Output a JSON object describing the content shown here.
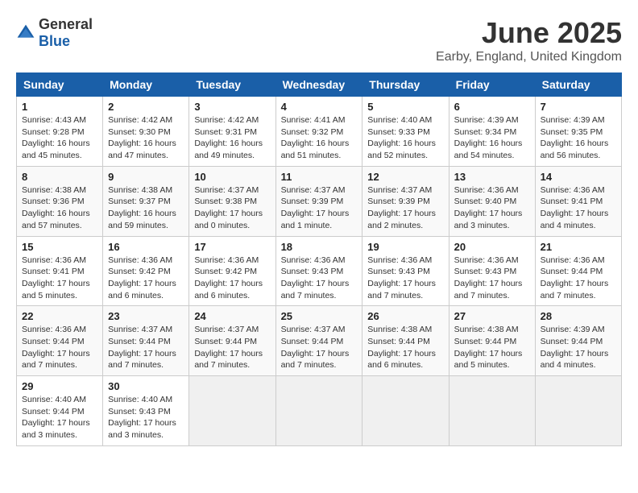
{
  "logo": {
    "general": "General",
    "blue": "Blue"
  },
  "title": "June 2025",
  "subtitle": "Earby, England, United Kingdom",
  "days_of_week": [
    "Sunday",
    "Monday",
    "Tuesday",
    "Wednesday",
    "Thursday",
    "Friday",
    "Saturday"
  ],
  "weeks": [
    [
      {
        "day": "1",
        "info": "Sunrise: 4:43 AM\nSunset: 9:28 PM\nDaylight: 16 hours and 45 minutes."
      },
      {
        "day": "2",
        "info": "Sunrise: 4:42 AM\nSunset: 9:30 PM\nDaylight: 16 hours and 47 minutes."
      },
      {
        "day": "3",
        "info": "Sunrise: 4:42 AM\nSunset: 9:31 PM\nDaylight: 16 hours and 49 minutes."
      },
      {
        "day": "4",
        "info": "Sunrise: 4:41 AM\nSunset: 9:32 PM\nDaylight: 16 hours and 51 minutes."
      },
      {
        "day": "5",
        "info": "Sunrise: 4:40 AM\nSunset: 9:33 PM\nDaylight: 16 hours and 52 minutes."
      },
      {
        "day": "6",
        "info": "Sunrise: 4:39 AM\nSunset: 9:34 PM\nDaylight: 16 hours and 54 minutes."
      },
      {
        "day": "7",
        "info": "Sunrise: 4:39 AM\nSunset: 9:35 PM\nDaylight: 16 hours and 56 minutes."
      }
    ],
    [
      {
        "day": "8",
        "info": "Sunrise: 4:38 AM\nSunset: 9:36 PM\nDaylight: 16 hours and 57 minutes."
      },
      {
        "day": "9",
        "info": "Sunrise: 4:38 AM\nSunset: 9:37 PM\nDaylight: 16 hours and 59 minutes."
      },
      {
        "day": "10",
        "info": "Sunrise: 4:37 AM\nSunset: 9:38 PM\nDaylight: 17 hours and 0 minutes."
      },
      {
        "day": "11",
        "info": "Sunrise: 4:37 AM\nSunset: 9:39 PM\nDaylight: 17 hours and 1 minute."
      },
      {
        "day": "12",
        "info": "Sunrise: 4:37 AM\nSunset: 9:39 PM\nDaylight: 17 hours and 2 minutes."
      },
      {
        "day": "13",
        "info": "Sunrise: 4:36 AM\nSunset: 9:40 PM\nDaylight: 17 hours and 3 minutes."
      },
      {
        "day": "14",
        "info": "Sunrise: 4:36 AM\nSunset: 9:41 PM\nDaylight: 17 hours and 4 minutes."
      }
    ],
    [
      {
        "day": "15",
        "info": "Sunrise: 4:36 AM\nSunset: 9:41 PM\nDaylight: 17 hours and 5 minutes."
      },
      {
        "day": "16",
        "info": "Sunrise: 4:36 AM\nSunset: 9:42 PM\nDaylight: 17 hours and 6 minutes."
      },
      {
        "day": "17",
        "info": "Sunrise: 4:36 AM\nSunset: 9:42 PM\nDaylight: 17 hours and 6 minutes."
      },
      {
        "day": "18",
        "info": "Sunrise: 4:36 AM\nSunset: 9:43 PM\nDaylight: 17 hours and 7 minutes."
      },
      {
        "day": "19",
        "info": "Sunrise: 4:36 AM\nSunset: 9:43 PM\nDaylight: 17 hours and 7 minutes."
      },
      {
        "day": "20",
        "info": "Sunrise: 4:36 AM\nSunset: 9:43 PM\nDaylight: 17 hours and 7 minutes."
      },
      {
        "day": "21",
        "info": "Sunrise: 4:36 AM\nSunset: 9:44 PM\nDaylight: 17 hours and 7 minutes."
      }
    ],
    [
      {
        "day": "22",
        "info": "Sunrise: 4:36 AM\nSunset: 9:44 PM\nDaylight: 17 hours and 7 minutes."
      },
      {
        "day": "23",
        "info": "Sunrise: 4:37 AM\nSunset: 9:44 PM\nDaylight: 17 hours and 7 minutes."
      },
      {
        "day": "24",
        "info": "Sunrise: 4:37 AM\nSunset: 9:44 PM\nDaylight: 17 hours and 7 minutes."
      },
      {
        "day": "25",
        "info": "Sunrise: 4:37 AM\nSunset: 9:44 PM\nDaylight: 17 hours and 7 minutes."
      },
      {
        "day": "26",
        "info": "Sunrise: 4:38 AM\nSunset: 9:44 PM\nDaylight: 17 hours and 6 minutes."
      },
      {
        "day": "27",
        "info": "Sunrise: 4:38 AM\nSunset: 9:44 PM\nDaylight: 17 hours and 5 minutes."
      },
      {
        "day": "28",
        "info": "Sunrise: 4:39 AM\nSunset: 9:44 PM\nDaylight: 17 hours and 4 minutes."
      }
    ],
    [
      {
        "day": "29",
        "info": "Sunrise: 4:40 AM\nSunset: 9:44 PM\nDaylight: 17 hours and 3 minutes."
      },
      {
        "day": "30",
        "info": "Sunrise: 4:40 AM\nSunset: 9:43 PM\nDaylight: 17 hours and 3 minutes."
      },
      {
        "day": "",
        "info": ""
      },
      {
        "day": "",
        "info": ""
      },
      {
        "day": "",
        "info": ""
      },
      {
        "day": "",
        "info": ""
      },
      {
        "day": "",
        "info": ""
      }
    ]
  ]
}
